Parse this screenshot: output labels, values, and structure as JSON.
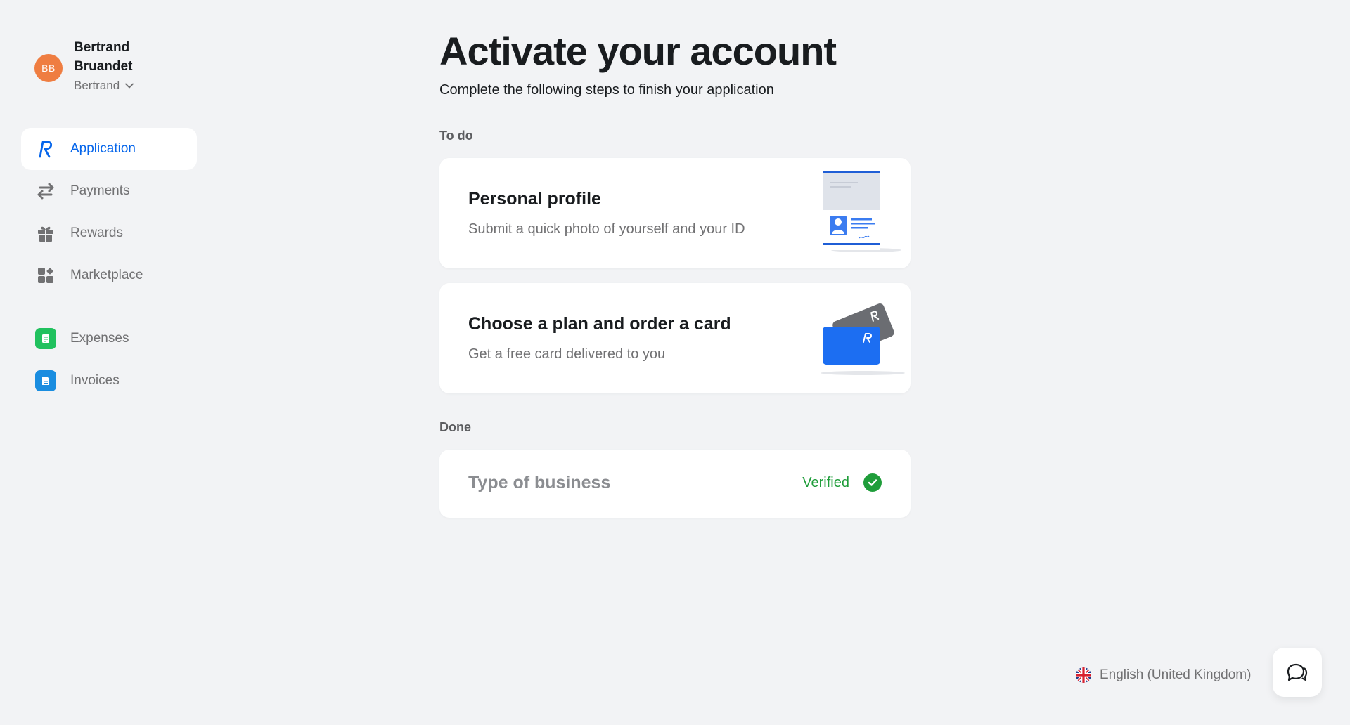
{
  "user": {
    "initials": "BB",
    "name": "Bertrand Bruandet",
    "account_switch": "Bertrand"
  },
  "nav": {
    "items": [
      {
        "label": "Application",
        "icon": "revolut-r-icon",
        "active": true
      },
      {
        "label": "Payments",
        "icon": "transfer-arrows-icon"
      },
      {
        "label": "Rewards",
        "icon": "gift-icon"
      },
      {
        "label": "Marketplace",
        "icon": "apps-grid-icon"
      }
    ],
    "apps": [
      {
        "label": "Expenses",
        "icon": "expenses-receipt-icon",
        "color": "#21c15e"
      },
      {
        "label": "Invoices",
        "icon": "invoices-document-icon",
        "color": "#1a8de0"
      }
    ]
  },
  "main": {
    "title": "Activate your account",
    "subtitle": "Complete the following steps to finish your application",
    "todo_label": "To do",
    "todo_cards": [
      {
        "title": "Personal profile",
        "description": "Submit a quick photo of yourself and your ID",
        "illustration": "id-document-illustration"
      },
      {
        "title": "Choose a plan and order a card",
        "description": "Get a free card delivered to you",
        "illustration": "cards-illustration"
      }
    ],
    "done_label": "Done",
    "done_cards": [
      {
        "title": "Type of business",
        "status": "Verified"
      }
    ]
  },
  "footer": {
    "language": "English (United Kingdom)",
    "language_icon": "uk-flag-icon",
    "chat_icon": "chat-bubbles-icon"
  },
  "colors": {
    "accent": "#0666eb",
    "background": "#f2f3f5",
    "verified": "#1f9d3a",
    "avatar": "#ef7d41"
  }
}
